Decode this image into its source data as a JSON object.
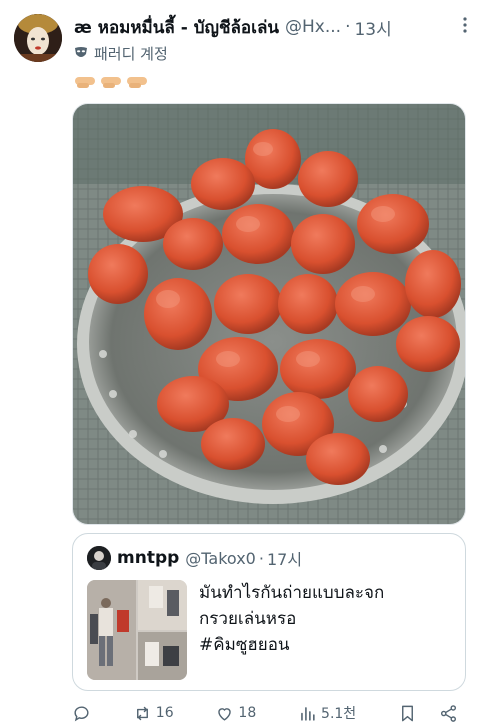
{
  "post": {
    "display_name": "æ หอมหมื่นลี้ - บัญชีล้อเล่น",
    "handle": "@Hx...",
    "separator": "·",
    "time": "13시",
    "more_icon": "more-vertical-icon",
    "parody_label": "패러디 계정",
    "emoji": [
      "🫱",
      "🫱",
      "🫱"
    ]
  },
  "quote": {
    "name": "mntpp",
    "handle": "@Takox0",
    "separator": "·",
    "time": "17시",
    "text": "มันทำไรกันถ่ายแบบละจก\nกรวยเล่นหรอ\n#คิมซูฮยอน"
  },
  "actions": {
    "reply_icon": "reply-icon",
    "retweet_count": "16",
    "like_count": "18",
    "views_count": "5.1천",
    "bookmark_icon": "bookmark-icon",
    "share_icon": "share-icon"
  },
  "colors": {
    "text": "#0f1419",
    "muted": "#536471",
    "border": "#cfd9de",
    "sausage": "#e0573c"
  }
}
